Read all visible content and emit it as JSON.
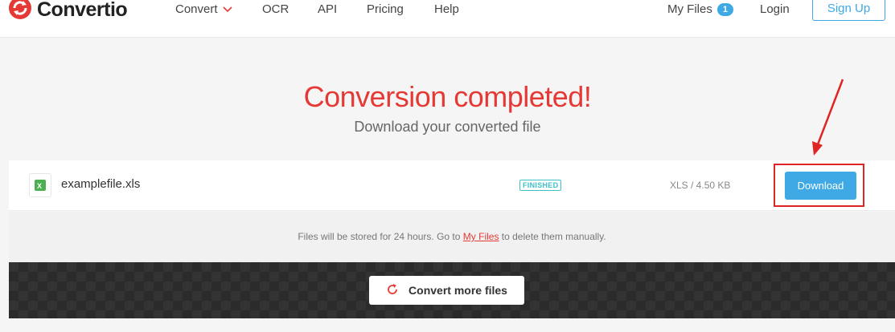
{
  "brand": {
    "name": "Convertio",
    "accent": "#e53935",
    "blue": "#3ea9e4"
  },
  "nav": {
    "convert": "Convert",
    "ocr": "OCR",
    "api": "API",
    "pricing": "Pricing",
    "help": "Help",
    "my_files": "My Files",
    "my_files_count": "1",
    "login": "Login",
    "signup": "Sign Up"
  },
  "hero": {
    "title": "Conversion completed!",
    "subtitle": "Download your converted file"
  },
  "file": {
    "icon": "excel-file-icon",
    "name": "examplefile.xls",
    "status": "FINISHED",
    "size": "XLS / 4.50 KB",
    "download_label": "Download"
  },
  "notice": {
    "before": "Files will be stored for 24 hours. Go to ",
    "link": "My Files",
    "after": " to delete them manually."
  },
  "footer": {
    "convert_more": "Convert more files"
  }
}
